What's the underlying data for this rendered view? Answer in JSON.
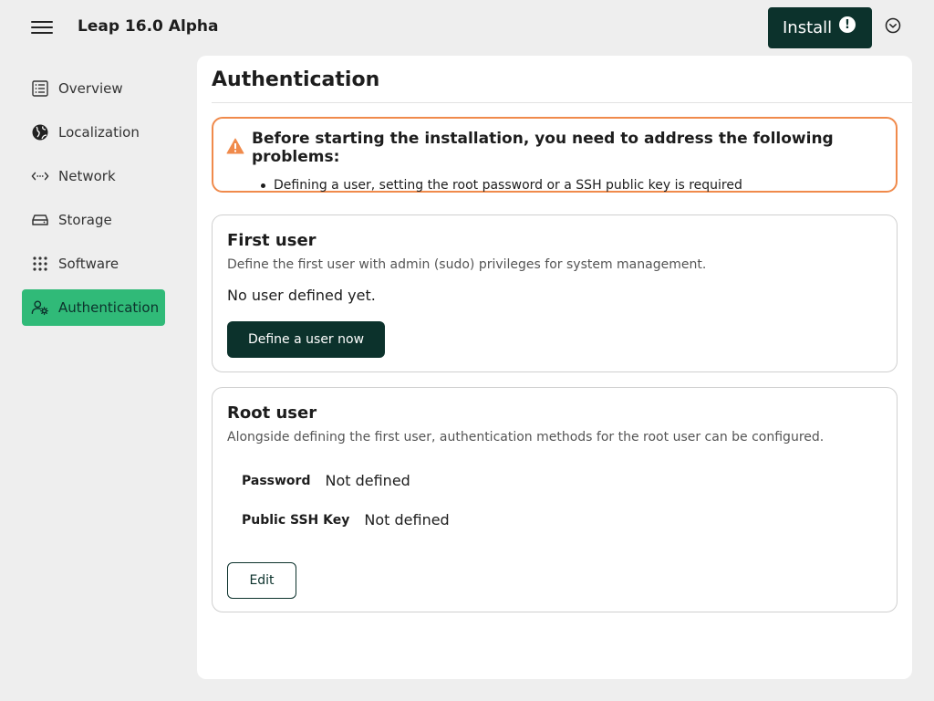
{
  "header": {
    "app_title": "Leap 16.0 Alpha",
    "install_label": "Install",
    "install_badge": "!"
  },
  "sidebar": {
    "items": [
      {
        "label": "Overview",
        "icon": "list-icon"
      },
      {
        "label": "Localization",
        "icon": "globe-icon"
      },
      {
        "label": "Network",
        "icon": "network-icon"
      },
      {
        "label": "Storage",
        "icon": "storage-icon"
      },
      {
        "label": "Software",
        "icon": "apps-grid-icon"
      },
      {
        "label": "Authentication",
        "icon": "user-settings-icon",
        "active": true
      }
    ]
  },
  "main": {
    "title": "Authentication",
    "alert": {
      "title": "Before starting the installation, you need to address the following problems:",
      "items": [
        "Defining a user, setting the root password or a SSH public key is required"
      ]
    },
    "first_user": {
      "title": "First user",
      "description": "Define the first user with admin (sudo) privileges for system management.",
      "status": "No user defined yet.",
      "button": "Define a user now"
    },
    "root_user": {
      "title": "Root user",
      "description": "Alongside defining the first user, authentication methods for the root user can be configured.",
      "password_label": "Password",
      "password_value": "Not defined",
      "ssh_label": "Public SSH Key",
      "ssh_value": "Not defined",
      "edit_button": "Edit"
    }
  },
  "colors": {
    "accent": "#30ba78",
    "dark": "#0c322c",
    "warning": "#f08a4b"
  }
}
